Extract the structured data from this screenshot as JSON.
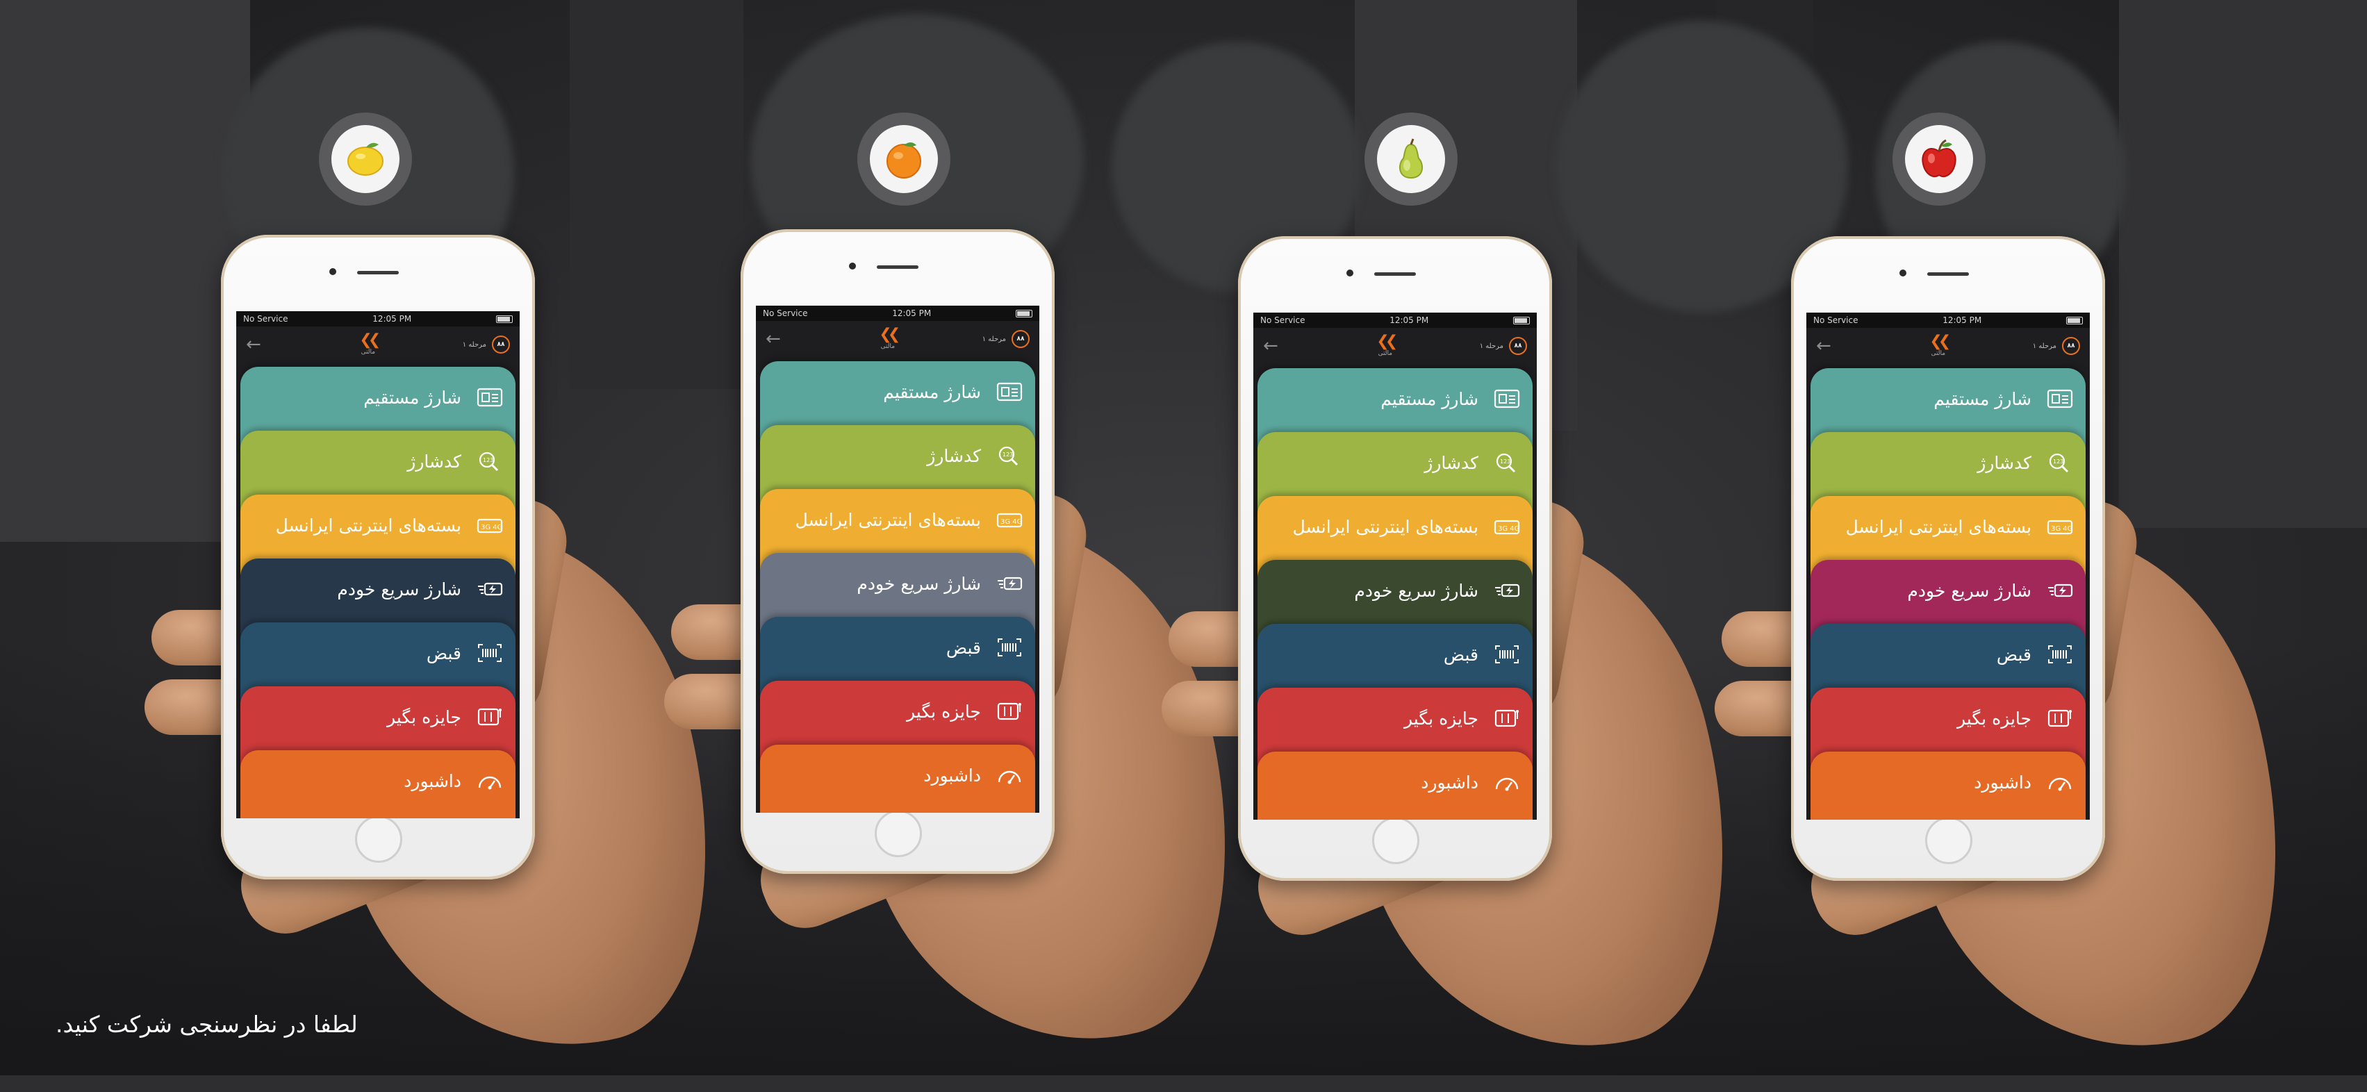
{
  "status_bar": {
    "carrier": "No Service",
    "time": "12:05 PM"
  },
  "nav": {
    "back_glyph": "←",
    "logo_text": "مالتی",
    "level_label": "مرحله ۱",
    "level_badge": "۸۸"
  },
  "menu_items": [
    {
      "label": "شارژ مستقیم",
      "icon": "sim-card-icon"
    },
    {
      "label": "کدشارژ",
      "icon": "code-search-icon"
    },
    {
      "label": "بسته‌های اینترنتی ایرانسل",
      "icon": "internet-package-icon"
    },
    {
      "label": "شارژ سریع خودم",
      "icon": "quick-charge-icon"
    },
    {
      "label": "قبض",
      "icon": "barcode-icon"
    },
    {
      "label": "جایزه بگیر",
      "icon": "slot-machine-icon"
    },
    {
      "label": "داشبورد",
      "icon": "gauge-icon"
    }
  ],
  "phones": [
    {
      "fruit": "lemon",
      "fruit_icon": "lemon-icon",
      "colors": [
        "#5ba69c",
        "#9cb545",
        "#efae31",
        "#27384a",
        "#28506a",
        "#cc3a3a",
        "#e56a26"
      ]
    },
    {
      "fruit": "orange",
      "fruit_icon": "orange-icon",
      "colors": [
        "#5ba69c",
        "#9cb545",
        "#efae31",
        "#6d7584",
        "#28506a",
        "#cc3a3a",
        "#e56a26"
      ]
    },
    {
      "fruit": "pear",
      "fruit_icon": "pear-icon",
      "colors": [
        "#5ba69c",
        "#9cb545",
        "#efae31",
        "#3b4a2e",
        "#28506a",
        "#cc3a3a",
        "#e56a26"
      ]
    },
    {
      "fruit": "apple",
      "fruit_icon": "apple-icon",
      "colors": [
        "#5ba69c",
        "#9cb545",
        "#efae31",
        "#a3285a",
        "#28506a",
        "#cc3a3a",
        "#e56a26"
      ]
    }
  ],
  "footer": {
    "text": "لطفا در نظرسنجی شرکت کنید."
  }
}
